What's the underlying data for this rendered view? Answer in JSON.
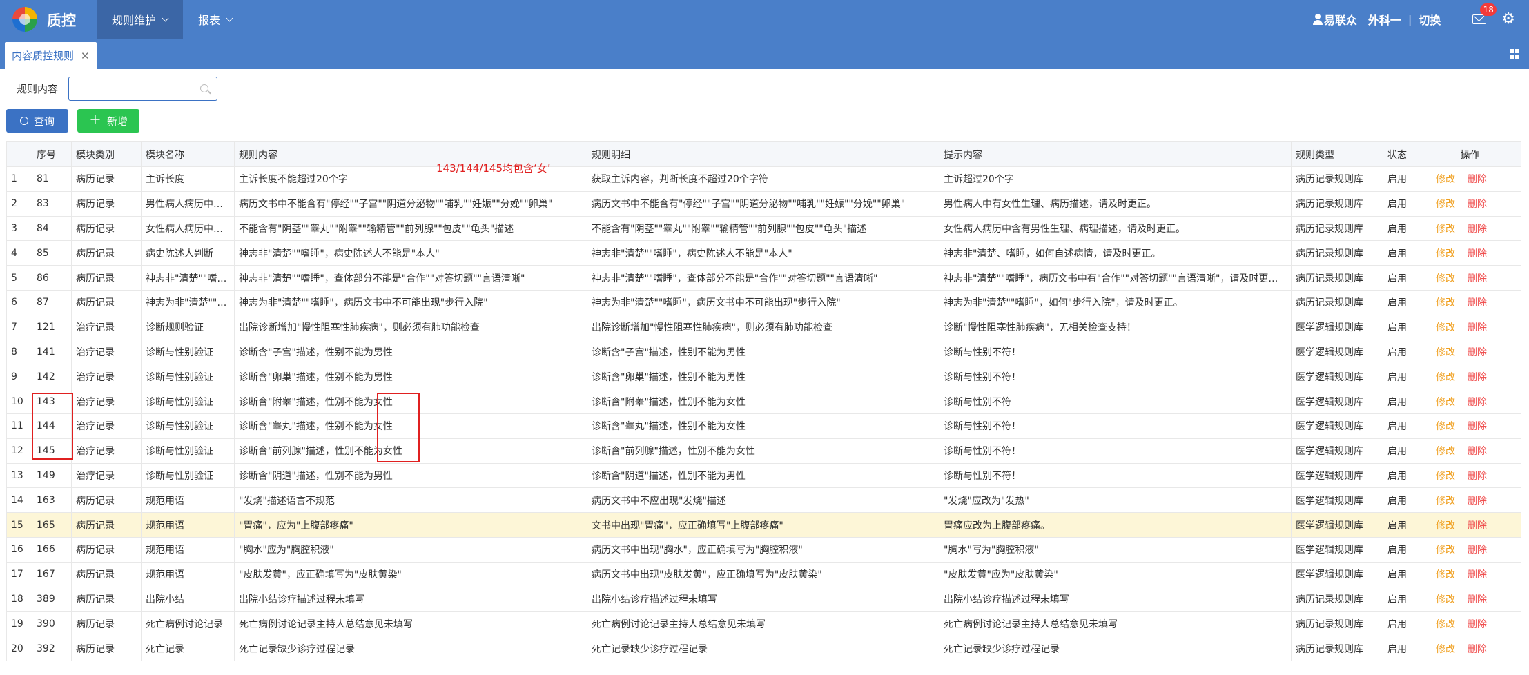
{
  "header": {
    "brand": "质控",
    "nav": [
      {
        "label": "规则维护",
        "active": true
      },
      {
        "label": "报表",
        "active": false
      }
    ],
    "user_name": "易联众",
    "dept": "外科一",
    "separator": "|",
    "switch_label": "切换",
    "mail_count": "18"
  },
  "tabs": [
    {
      "label": "内容质控规则"
    }
  ],
  "form": {
    "label": "规则内容",
    "input_value": "",
    "query_label": "查询",
    "add_label": "新增"
  },
  "table": {
    "columns": [
      "",
      "序号",
      "模块类别",
      "模块名称",
      "规则内容",
      "规则明细",
      "提示内容",
      "规则类型",
      "状态",
      "操作"
    ],
    "edit_label": "修改",
    "delete_label": "删除",
    "highlight_row": 15,
    "rows": [
      [
        "1",
        "81",
        "病历记录",
        "主诉长度",
        "主诉长度不能超过20个字",
        "获取主诉内容，判断长度不超过20个字符",
        "主诉超过20个字",
        "病历记录规则库",
        "启用"
      ],
      [
        "2",
        "83",
        "病历记录",
        "男性病人病历中含有女性生理描述",
        "病历文书中不能含有\"停经\"\"子宫\"\"阴道分泌物\"\"哺乳\"\"妊娠\"\"分娩\"\"卵巢\"",
        "病历文书中不能含有\"停经\"\"子宫\"\"阴道分泌物\"\"哺乳\"\"妊娠\"\"分娩\"\"卵巢\"",
        "男性病人中有女性生理、病历描述，请及时更正。",
        "病历记录规则库",
        "启用"
      ],
      [
        "3",
        "84",
        "病历记录",
        "女性病人病历中含有男性生理描述",
        "不能含有\"阴茎\"\"睾丸\"\"附睾\"\"输精管\"\"前列腺\"\"包皮\"\"龟头\"描述",
        "不能含有\"阴茎\"\"睾丸\"\"附睾\"\"输精管\"\"前列腺\"\"包皮\"\"龟头\"描述",
        "女性病人病历中含有男性生理、病理描述，请及时更正。",
        "病历记录规则库",
        "启用"
      ],
      [
        "4",
        "85",
        "病历记录",
        "病史陈述人判断",
        "神志非\"清楚\"\"嗜睡\"，病史陈述人不能是\"本人\"",
        "神志非\"清楚\"\"嗜睡\"，病史陈述人不能是\"本人\"",
        "神志非\"清楚、嗜睡，如何自述病情，请及时更正。",
        "病历记录规则库",
        "启用"
      ],
      [
        "5",
        "86",
        "病历记录",
        "神志非\"清楚\"\"嗜睡\"查体部分",
        "神志非\"清楚\"\"嗜睡\"，查体部分不能是\"合作\"\"对答切题\"\"言语清晰\"",
        "神志非\"清楚\"\"嗜睡\"，查体部分不能是\"合作\"\"对答切题\"\"言语清晰\"",
        "神志非\"清楚\"\"嗜睡\"，病历文书中有\"合作\"\"对答切题\"\"言语清晰\"，请及时更正。",
        "病历记录规则库",
        "启用"
      ],
      [
        "6",
        "87",
        "病历记录",
        "神志为非\"清楚\"\"嗜睡\"步行入院",
        "神志为非\"清楚\"\"嗜睡\"，病历文书中不可能出现\"步行入院\"",
        "神志为非\"清楚\"\"嗜睡\"，病历文书中不可能出现\"步行入院\"",
        "神志为非\"清楚\"\"嗜睡\"，如何\"步行入院\"，请及时更正。",
        "病历记录规则库",
        "启用"
      ],
      [
        "7",
        "121",
        "治疗记录",
        "诊断规则验证",
        "出院诊断增加\"慢性阻塞性肺疾病\"，则必须有肺功能检查",
        "出院诊断增加\"慢性阻塞性肺疾病\"，则必须有肺功能检查",
        "诊断\"慢性阻塞性肺疾病\"，无相关检查支持！",
        "医学逻辑规则库",
        "启用"
      ],
      [
        "8",
        "141",
        "治疗记录",
        "诊断与性别验证",
        "诊断含\"子宫\"描述，性别不能为男性",
        "诊断含\"子宫\"描述，性别不能为男性",
        "诊断与性别不符！",
        "医学逻辑规则库",
        "启用"
      ],
      [
        "9",
        "142",
        "治疗记录",
        "诊断与性别验证",
        "诊断含\"卵巢\"描述，性别不能为男性",
        "诊断含\"卵巢\"描述，性别不能为男性",
        "诊断与性别不符！",
        "医学逻辑规则库",
        "启用"
      ],
      [
        "10",
        "143",
        "治疗记录",
        "诊断与性别验证",
        "诊断含\"附睾\"描述，性别不能为女性",
        "诊断含\"附睾\"描述，性别不能为女性",
        "诊断与性别不符",
        "医学逻辑规则库",
        "启用"
      ],
      [
        "11",
        "144",
        "治疗记录",
        "诊断与性别验证",
        "诊断含\"睾丸\"描述，性别不能为女性",
        "诊断含\"睾丸\"描述，性别不能为女性",
        "诊断与性别不符！",
        "医学逻辑规则库",
        "启用"
      ],
      [
        "12",
        "145",
        "治疗记录",
        "诊断与性别验证",
        "诊断含\"前列腺\"描述，性别不能为女性",
        "诊断含\"前列腺\"描述，性别不能为女性",
        "诊断与性别不符！",
        "医学逻辑规则库",
        "启用"
      ],
      [
        "13",
        "149",
        "治疗记录",
        "诊断与性别验证",
        "诊断含\"阴道\"描述，性别不能为男性",
        "诊断含\"阴道\"描述，性别不能为男性",
        "诊断与性别不符！",
        "医学逻辑规则库",
        "启用"
      ],
      [
        "14",
        "163",
        "病历记录",
        "规范用语",
        "\"发烧\"描述语言不规范",
        "病历文书中不应出现\"发烧\"描述",
        "\"发烧\"应改为\"发热\"",
        "医学逻辑规则库",
        "启用"
      ],
      [
        "15",
        "165",
        "病历记录",
        "规范用语",
        "\"胃痛\"，应为\"上腹部疼痛\"",
        "文书中出现\"胃痛\"，应正确填写\"上腹部疼痛\"",
        "胃痛应改为上腹部疼痛。",
        "医学逻辑规则库",
        "启用"
      ],
      [
        "16",
        "166",
        "病历记录",
        "规范用语",
        "\"胸水\"应为\"胸腔积液\"",
        "病历文书中出现\"胸水\"，应正确填写为\"胸腔积液\"",
        "\"胸水\"写为\"胸腔积液\"",
        "医学逻辑规则库",
        "启用"
      ],
      [
        "17",
        "167",
        "病历记录",
        "规范用语",
        "\"皮肤发黄\"，应正确填写为\"皮肤黄染\"",
        "病历文书中出现\"皮肤发黄\"，应正确填写为\"皮肤黄染\"",
        "\"皮肤发黄\"应为\"皮肤黄染\"",
        "医学逻辑规则库",
        "启用"
      ],
      [
        "18",
        "389",
        "病历记录",
        "出院小结",
        "出院小结诊疗描述过程未填写",
        "出院小结诊疗描述过程未填写",
        "出院小结诊疗描述过程未填写",
        "病历记录规则库",
        "启用"
      ],
      [
        "19",
        "390",
        "病历记录",
        "死亡病例讨论记录",
        "死亡病例讨论记录主持人总结意见未填写",
        "死亡病例讨论记录主持人总结意见未填写",
        "死亡病例讨论记录主持人总结意见未填写",
        "病历记录规则库",
        "启用"
      ],
      [
        "20",
        "392",
        "病历记录",
        "死亡记录",
        "死亡记录缺少诊疗过程记录",
        "死亡记录缺少诊疗过程记录",
        "死亡记录缺少诊疗过程记录",
        "病历记录规则库",
        "启用"
      ]
    ]
  },
  "annotation": {
    "text": "143/144/145均包含‘女’"
  }
}
